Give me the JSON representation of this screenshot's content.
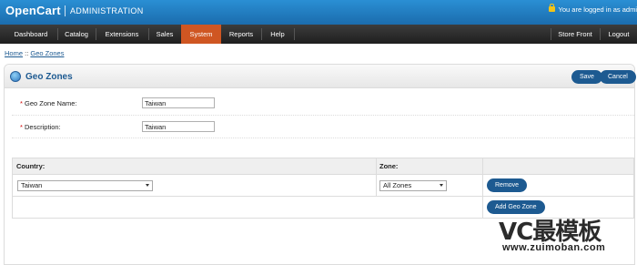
{
  "header": {
    "logo": "OpenCart",
    "admin_label": "ADMINISTRATION",
    "login_status": "You are logged in as admi",
    "lock_icon": "lock-icon"
  },
  "menu": {
    "items": [
      {
        "label": "Dashboard"
      },
      {
        "label": "Catalog"
      },
      {
        "label": "Extensions"
      },
      {
        "label": "Sales"
      },
      {
        "label": "System",
        "active": true
      },
      {
        "label": "Reports"
      },
      {
        "label": "Help"
      }
    ],
    "right_items": [
      {
        "label": "Store Front"
      },
      {
        "label": "Logout"
      }
    ],
    "active_color": "#cf5622"
  },
  "breadcrumb": {
    "home": "Home",
    "separator": "::",
    "current": "Geo Zones"
  },
  "box": {
    "title": "Geo Zones",
    "title_icon": "globe-icon",
    "save_label": "Save",
    "cancel_label": "Cancel"
  },
  "form": {
    "required_marker": "*",
    "name_label": "Geo Zone Name:",
    "name_value": "Taiwan",
    "description_label": "Description:",
    "description_value": "Taiwan"
  },
  "zones": {
    "country_header": "Country:",
    "zone_header": "Zone:",
    "rows": [
      {
        "country": "Taiwan",
        "zone": "All Zones",
        "remove_label": "Remove"
      }
    ],
    "add_label": "Add Geo Zone"
  },
  "watermark": {
    "big": "VC最模板",
    "small": "www.zuimoban.com"
  },
  "colors": {
    "header_blue": "#1b6cad",
    "link_blue": "#1d5a91",
    "button_blue": "#1d5a91",
    "required_red": "#d10000"
  }
}
